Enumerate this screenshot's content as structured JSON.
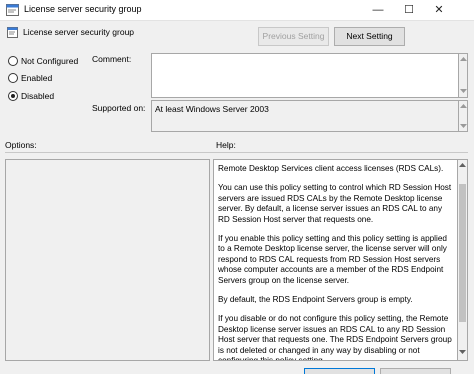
{
  "window": {
    "title": "License server security group",
    "minimize_glyph": "—",
    "maximize_glyph": "☐",
    "close_glyph": "✕"
  },
  "header": {
    "setting_name": "License server security group",
    "previous_button": "Previous Setting",
    "next_button": "Next Setting"
  },
  "state": {
    "options": [
      {
        "label": "Not Configured",
        "selected": false
      },
      {
        "label": "Enabled",
        "selected": false
      },
      {
        "label": "Disabled",
        "selected": true
      }
    ]
  },
  "comment": {
    "label": "Comment:",
    "value": ""
  },
  "supported": {
    "label": "Supported on:",
    "value": "At least Windows Server 2003"
  },
  "options_panel": {
    "label": "Options:"
  },
  "help_panel": {
    "label": "Help:",
    "paragraphs": [
      "Remote Desktop Services client access licenses (RDS CALs).",
      "You can use this policy setting to control which RD Session Host servers are issued RDS CALs by the Remote Desktop license server. By default, a license server issues an RDS CAL to any RD Session Host server that requests one.",
      "If you enable this policy setting and this policy setting is applied to a Remote Desktop license server, the license server will only respond to RDS CAL requests from RD Session Host servers whose computer accounts are a member of the RDS Endpoint Servers group on the license server.",
      "By default, the RDS Endpoint Servers group is empty.",
      "If you disable or do not configure this policy setting, the Remote Desktop license server issues an RDS CAL to any RD Session Host server that requests one. The RDS Endpoint Servers group is not deleted or changed in any way by disabling or not configuring this policy setting."
    ]
  },
  "colors": {
    "accent": "#0078d7",
    "window_bg": "#f0f0f0"
  }
}
